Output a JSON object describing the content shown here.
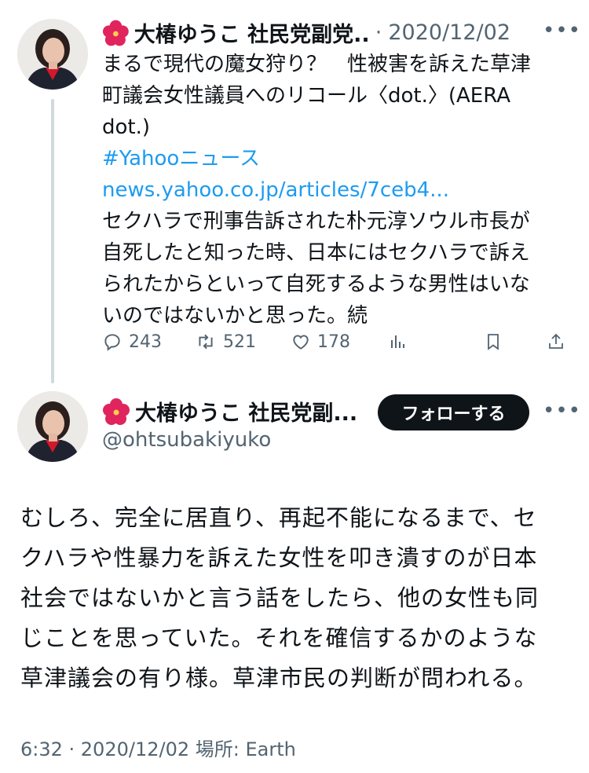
{
  "tweet1": {
    "author": "大椿ゆうこ 社民党副党...",
    "dot": "·",
    "date": "2020/12/02",
    "lines": [
      "まるで現代の魔女狩り？　性被害を訴えた草津",
      "町議会女性議員へのリコール〈dot.〉(AERA",
      "dot.)"
    ],
    "hashtag": "#Yahooニュース",
    "url": "news.yahoo.co.jp/articles/7ceb4...",
    "lines2": [
      "セクハラで刑事告訴された朴元淳ソウル市長が",
      "自死したと知った時、日本にはセクハラで訴え",
      "られたからといって自死するような男性はいな",
      "いのではないかと思った。続"
    ],
    "actions": {
      "replies": "243",
      "reposts": "521",
      "likes": "178"
    }
  },
  "tweet2": {
    "author": "大椿ゆうこ 社民党副...",
    "handle": "@ohtsubakiyuko",
    "follow_label": "フォローする",
    "text_lines": [
      "むしろ、完全に居直り、再起不能になるまで、セ",
      "クハラや性暴力を訴えた女性を叩き潰すのが日本",
      "社会ではないかと言う話をしたら、他の女性も同",
      "じことを思っていた。それを確信するかのような",
      "草津議会の有り様。草津市民の判断が問われる。"
    ],
    "meta": "6:32 · 2020/12/02 場所: Earth"
  },
  "icons": [
    "hibiscus-icon",
    "more-icon",
    "reply-icon",
    "repost-icon",
    "like-icon",
    "views-icon",
    "bookmark-icon",
    "share-icon"
  ]
}
